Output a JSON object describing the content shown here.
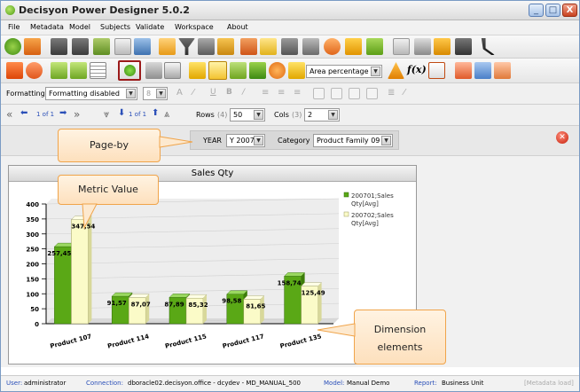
{
  "window": {
    "title": "Decisyon Power Designer 5.0.2",
    "min": "_",
    "max": "□",
    "close": "X"
  },
  "menu": [
    "File",
    "Metadata",
    "Model",
    "Subjects",
    "Validate",
    "Workspace",
    "About"
  ],
  "toolbar2": {
    "area_select": "Area percentage",
    "fx": "f(x)"
  },
  "toolbar3": {
    "formatting_label": "Formatting",
    "formatting_value": "Formatting disabled",
    "size_value": "8",
    "buttons": [
      "U",
      "B",
      "/"
    ]
  },
  "nav": {
    "page1": "1 of 1",
    "page2": "1 of 1",
    "rows_label": "Rows",
    "rows_count": "(4)",
    "rows_value": "50",
    "cols_label": "Cols",
    "cols_count": "(3)",
    "cols_value": "2"
  },
  "pageby": {
    "year_label": "YEAR",
    "year_value": "Y 2007",
    "category_label": "Category",
    "category_value": "Product Family 09"
  },
  "chart_data": {
    "type": "bar",
    "title": "Sales Qty",
    "categories": [
      "Product 107",
      "Product 114",
      "Product 115",
      "Product 117",
      "Product 135"
    ],
    "series": [
      {
        "name": "200701;Sales Qty[Avg]",
        "values": [
          257.45,
          91.57,
          87.89,
          98.58,
          158.74
        ]
      },
      {
        "name": "200702;Sales Qty[Avg]",
        "values": [
          347.54,
          87.07,
          85.32,
          81.65,
          125.49
        ]
      }
    ],
    "value_labels": [
      [
        "257,45",
        "91,57",
        "87,89",
        "98,58",
        "158,74"
      ],
      [
        "347,54",
        "87,07",
        "85,32",
        "81,65",
        "125,49"
      ]
    ],
    "yticks": [
      "0",
      "50",
      "100",
      "150",
      "200",
      "250",
      "300",
      "350",
      "400"
    ],
    "ylim": [
      0,
      400
    ],
    "legend_position": "top-right",
    "colors": {
      "s1": "#5aa816",
      "s2": "#fbfbc8"
    }
  },
  "callouts": {
    "pageby": "Page-by",
    "metric": "Metric Value",
    "dimension_line1": "Dimension",
    "dimension_line2": "elements"
  },
  "status": {
    "user_label": "User:",
    "user": "administrator",
    "connection_label": "Connection:",
    "connection": "dboracle02.decisyon.office - dcydev - MD_MANUAL_500",
    "model_label": "Model:",
    "model": "Manual Demo",
    "report_label": "Report:",
    "report": "Business Unit",
    "metadata": "[Metadata load]"
  }
}
